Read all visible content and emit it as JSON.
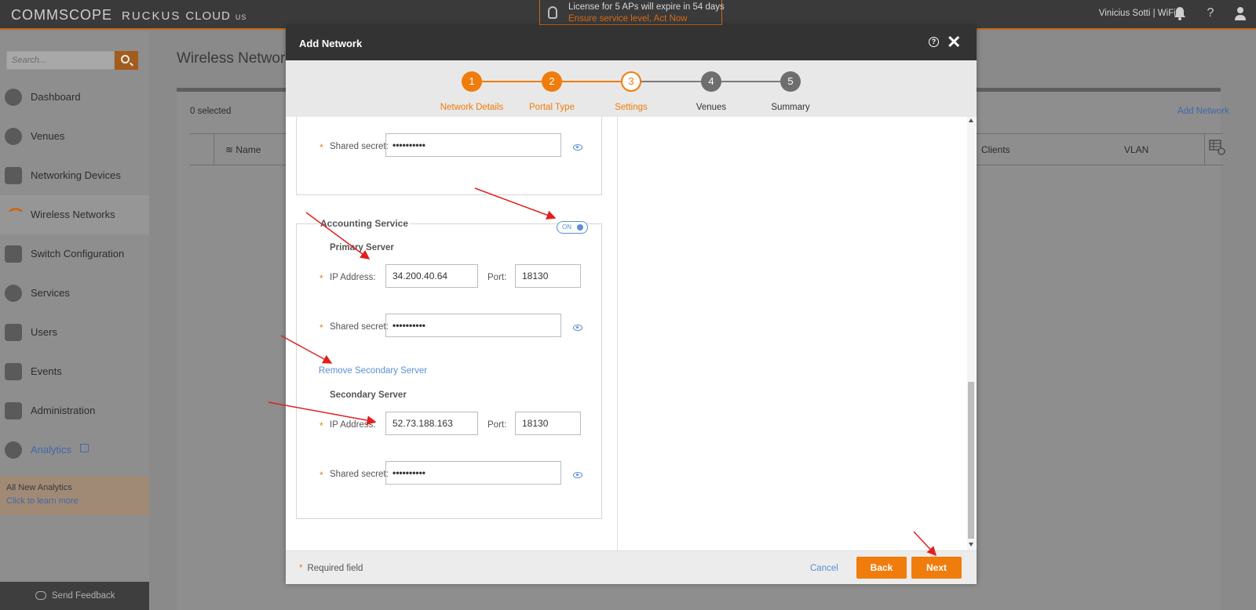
{
  "topbar": {
    "brand_commscope": "COMMSCOPE",
    "brand_ruckus": "RUCKUS",
    "brand_cloud": "CLOUD",
    "brand_region": "US",
    "license_line1": "License for 5 APs will expire in 54 days",
    "license_line2": "Ensure service level, Act Now",
    "user": "Vinicius Sotti  |  WiFire",
    "icons": [
      "bell-icon",
      "help-icon",
      "user-icon"
    ]
  },
  "sidebar": {
    "search_placeholder": "Search...",
    "items": [
      {
        "label": "Dashboard",
        "icon": "dashboard-icon"
      },
      {
        "label": "Venues",
        "icon": "location-pin-icon"
      },
      {
        "label": "Networking Devices",
        "icon": "device-icon"
      },
      {
        "label": "Wireless Networks",
        "icon": "wifi-icon",
        "active": true
      },
      {
        "label": "Switch Configuration",
        "icon": "switch-icon"
      },
      {
        "label": "Services",
        "icon": "gear-icon"
      },
      {
        "label": "Users",
        "icon": "user-icon"
      },
      {
        "label": "Events",
        "icon": "events-icon"
      },
      {
        "label": "Administration",
        "icon": "wrench-icon"
      },
      {
        "label": "Analytics",
        "icon": "pie-chart-icon"
      }
    ],
    "promo_title": "All New Analytics",
    "promo_link": "Click to learn more",
    "feedback": "Send Feedback"
  },
  "main": {
    "title": "Wireless Networks",
    "selected": "0 selected",
    "add_network": "Add Network",
    "columns": [
      "Name",
      "Clients",
      "VLAN"
    ]
  },
  "modal": {
    "title": "Add Network",
    "steps": [
      {
        "number": "1",
        "label": "Network Details",
        "state": "done"
      },
      {
        "number": "2",
        "label": "Portal Type",
        "state": "done"
      },
      {
        "number": "3",
        "label": "Settings",
        "state": "current"
      },
      {
        "number": "4",
        "label": "Venues",
        "state": "todo"
      },
      {
        "number": "5",
        "label": "Summary",
        "state": "todo"
      }
    ],
    "auth_shared_secret_label": "Shared secret:",
    "auth_shared_secret_value": "••••••••••",
    "accounting": {
      "legend": "Accounting Service",
      "toggle": "ON",
      "primary_title": "Primary Server",
      "ip_label": "IP Address:",
      "port_label": "Port:",
      "secret_label": "Shared secret:",
      "primary_ip": "34.200.40.64",
      "primary_port": "18130",
      "primary_secret": "••••••••••",
      "remove_secondary": "Remove Secondary Server",
      "secondary_title": "Secondary Server",
      "secondary_ip": "52.73.188.163",
      "secondary_port": "18130",
      "secondary_secret": "••••••••••"
    },
    "footer": {
      "required_note": "Required field",
      "cancel": "Cancel",
      "back": "Back",
      "next": "Next"
    }
  },
  "colors": {
    "accent": "#f07c0b",
    "link": "#5b8fd6",
    "annotation_arrow": "#e02020"
  }
}
